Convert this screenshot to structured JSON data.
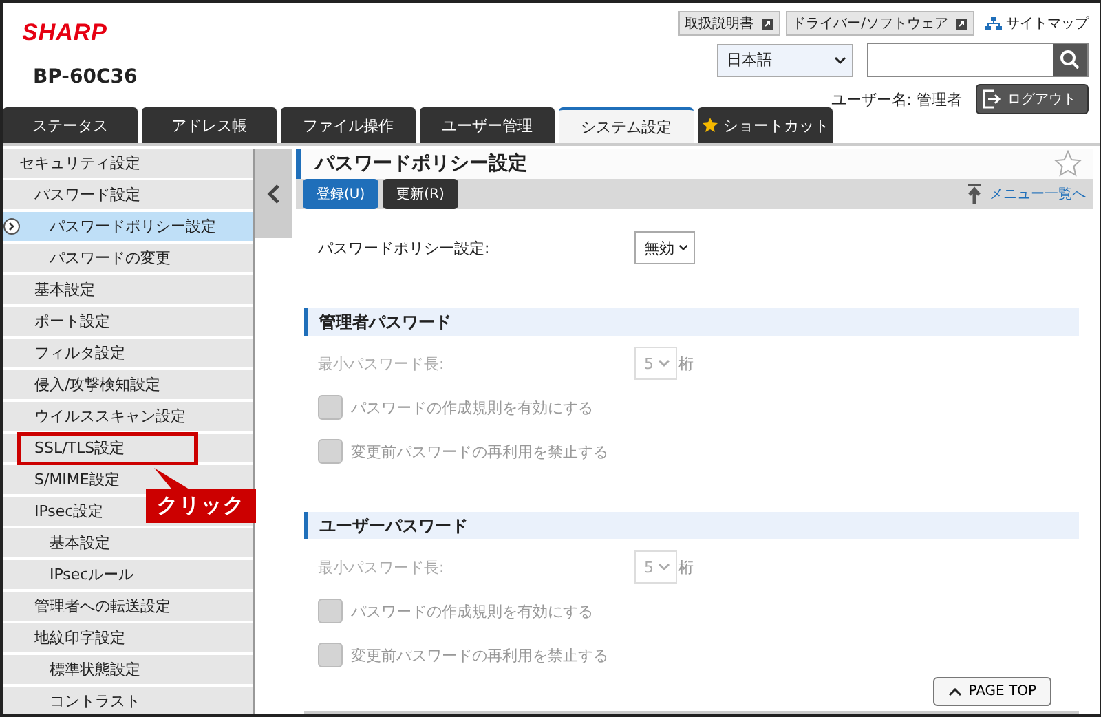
{
  "header": {
    "brand": "SHARP",
    "model": "BP-60C36",
    "links": [
      {
        "label": "取扱説明書",
        "kind": "external"
      },
      {
        "label": "ドライバー/ソフトウェア",
        "kind": "external"
      },
      {
        "label": "サイトマップ",
        "kind": "sitemap"
      }
    ],
    "language": "日本語",
    "user_label": "ユーザー名: 管理者",
    "logout": "ログアウト"
  },
  "tabs": [
    {
      "label": "ステータス",
      "selected": false,
      "starred": false
    },
    {
      "label": "アドレス帳",
      "selected": false,
      "starred": false
    },
    {
      "label": "ファイル操作",
      "selected": false,
      "starred": false
    },
    {
      "label": "ユーザー管理",
      "selected": false,
      "starred": false
    },
    {
      "label": "システム設定",
      "selected": true,
      "starred": false
    },
    {
      "label": "ショートカット",
      "selected": false,
      "starred": true
    }
  ],
  "sidebar": {
    "items": [
      {
        "label": "セキュリティ設定",
        "selected": false,
        "children": [
          {
            "label": "パスワード設定",
            "selected": false,
            "children": [
              {
                "label": "パスワードポリシー設定",
                "selected": true
              },
              {
                "label": "パスワードの変更",
                "selected": false
              }
            ]
          },
          {
            "label": "基本設定",
            "selected": false
          },
          {
            "label": "ポート設定",
            "selected": false
          },
          {
            "label": "フィルタ設定",
            "selected": false
          },
          {
            "label": "侵入/攻撃検知設定",
            "selected": false
          },
          {
            "label": "ウイルススキャン設定",
            "selected": false
          },
          {
            "label": "SSL/TLS設定",
            "selected": false,
            "highlighted": true
          },
          {
            "label": "S/MIME設定",
            "selected": false
          },
          {
            "label": "IPsec設定",
            "selected": false,
            "children": [
              {
                "label": "基本設定",
                "selected": false
              },
              {
                "label": "IPsecルール",
                "selected": false
              }
            ]
          },
          {
            "label": "管理者への転送設定",
            "selected": false
          },
          {
            "label": "地紋印字設定",
            "selected": false,
            "children": [
              {
                "label": "標準状態設定",
                "selected": false
              },
              {
                "label": "コントラスト",
                "selected": false
              }
            ]
          }
        ]
      }
    ]
  },
  "callout": {
    "label": "クリック"
  },
  "main": {
    "title": "パスワードポリシー設定",
    "buttons": [
      {
        "label": "登録(U)",
        "kind": "primary"
      },
      {
        "label": "更新(R)",
        "kind": "secondary"
      }
    ],
    "menu_link": "メニュー一覧へ",
    "policy_row": {
      "label": "パスワードポリシー設定:",
      "value": "無効",
      "disabled": false
    },
    "sections": [
      {
        "title": "管理者パスワード",
        "min_length": {
          "label": "最小パスワード長:",
          "value": "5",
          "unit": "桁",
          "disabled": true
        },
        "options": [
          {
            "label": "パスワードの作成規則を有効にする",
            "checked": false,
            "disabled": true
          },
          {
            "label": "変更前パスワードの再利用を禁止する",
            "checked": false,
            "disabled": true
          }
        ]
      },
      {
        "title": "ユーザーパスワード",
        "min_length": {
          "label": "最小パスワード長:",
          "value": "5",
          "unit": "桁",
          "disabled": true
        },
        "options": [
          {
            "label": "パスワードの作成規則を有効にする",
            "checked": false,
            "disabled": true
          },
          {
            "label": "変更前パスワードの再利用を禁止する",
            "checked": false,
            "disabled": true
          }
        ]
      }
    ],
    "page_top": "PAGE TOP"
  }
}
